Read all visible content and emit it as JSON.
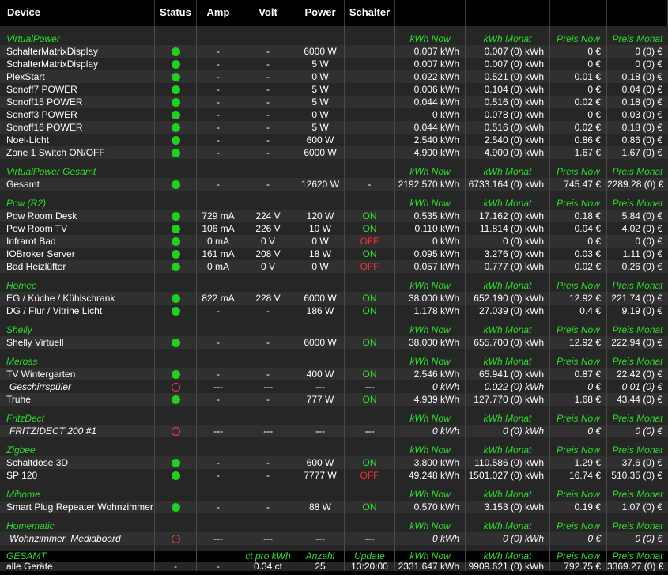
{
  "columns": [
    "Device",
    "Status",
    "Amp",
    "Volt",
    "Power",
    "Schalter",
    "",
    "",
    "",
    ""
  ],
  "section_cols": [
    "kWh Now",
    "kWh Monat",
    "Preis Now",
    "Preis Monat"
  ],
  "sections": [
    {
      "name": "VirtualPower",
      "rows": [
        {
          "device": "SchalterMatrixDisplay",
          "status": "on",
          "amp": "-",
          "volt": "-",
          "power": "6000 W",
          "switch": "",
          "kwh_now": "0.007 kWh",
          "kwh_month": "0.007 (0) kWh",
          "price_now": "0 €",
          "price_month": "0 (0) €"
        },
        {
          "device": "SchalterMatrixDisplay",
          "status": "on",
          "amp": "-",
          "volt": "-",
          "power": "5 W",
          "switch": "",
          "kwh_now": "0.007 kWh",
          "kwh_month": "0.007 (0) kWh",
          "price_now": "0 €",
          "price_month": "0 (0) €"
        },
        {
          "device": "PlexStart",
          "status": "on",
          "amp": "-",
          "volt": "-",
          "power": "0 W",
          "switch": "",
          "kwh_now": "0.022 kWh",
          "kwh_month": "0.521 (0) kWh",
          "price_now": "0.01 €",
          "price_month": "0.18 (0) €"
        },
        {
          "device": "Sonoff7 POWER",
          "status": "on",
          "amp": "-",
          "volt": "-",
          "power": "5 W",
          "switch": "",
          "kwh_now": "0.006 kWh",
          "kwh_month": "0.104 (0) kWh",
          "price_now": "0 €",
          "price_month": "0.04 (0) €"
        },
        {
          "device": "Sonoff15 POWER",
          "status": "on",
          "amp": "-",
          "volt": "-",
          "power": "5 W",
          "switch": "",
          "kwh_now": "0.044 kWh",
          "kwh_month": "0.516 (0) kWh",
          "price_now": "0.02 €",
          "price_month": "0.18 (0) €"
        },
        {
          "device": "Sonoff3 POWER",
          "status": "on",
          "amp": "-",
          "volt": "-",
          "power": "0 W",
          "switch": "",
          "kwh_now": "0 kWh",
          "kwh_month": "0.078 (0) kWh",
          "price_now": "0 €",
          "price_month": "0.03 (0) €"
        },
        {
          "device": "Sonoff16 POWER",
          "status": "on",
          "amp": "-",
          "volt": "-",
          "power": "5 W",
          "switch": "",
          "kwh_now": "0.044 kWh",
          "kwh_month": "0.516 (0) kWh",
          "price_now": "0.02 €",
          "price_month": "0.18 (0) €"
        },
        {
          "device": "Noel-Licht",
          "status": "on",
          "amp": "-",
          "volt": "-",
          "power": "600 W",
          "switch": "",
          "kwh_now": "2.540 kWh",
          "kwh_month": "2.540 (0) kWh",
          "price_now": "0.86 €",
          "price_month": "0.86 (0) €"
        },
        {
          "device": "Zone 1 Switch ON/OFF",
          "status": "on",
          "amp": "-",
          "volt": "-",
          "power": "6000 W",
          "switch": "",
          "kwh_now": "4.900 kWh",
          "kwh_month": "4.900 (0) kWh",
          "price_now": "1.67 €",
          "price_month": "1.67 (0) €"
        }
      ]
    },
    {
      "name": "VirtualPower Gesamt",
      "rows": [
        {
          "device": "Gesamt",
          "status": "on",
          "amp": "-",
          "volt": "-",
          "power": "12620 W",
          "switch": "-",
          "kwh_now": "2192.570 kWh",
          "kwh_month": "6733.164 (0) kWh",
          "price_now": "745.47 €",
          "price_month": "2289.28 (0) €"
        }
      ]
    },
    {
      "name": "Pow (R2)",
      "rows": [
        {
          "device": "Pow Room Desk",
          "status": "on",
          "amp": "729 mA",
          "volt": "224 V",
          "power": "120 W",
          "switch": "ON",
          "kwh_now": "0.535 kWh",
          "kwh_month": "17.162 (0) kWh",
          "price_now": "0.18 €",
          "price_month": "5.84 (0) €"
        },
        {
          "device": "Pow Room TV",
          "status": "on",
          "amp": "106 mA",
          "volt": "226 V",
          "power": "10 W",
          "switch": "ON",
          "kwh_now": "0.110 kWh",
          "kwh_month": "11.814 (0) kWh",
          "price_now": "0.04 €",
          "price_month": "4.02 (0) €"
        },
        {
          "device": "Infrarot Bad",
          "status": "on",
          "amp": "0 mA",
          "volt": "0 V",
          "power": "0 W",
          "switch": "OFF",
          "kwh_now": "0 kWh",
          "kwh_month": "0 (0) kWh",
          "price_now": "0 €",
          "price_month": "0 (0) €"
        },
        {
          "device": "IOBroker Server",
          "status": "on",
          "amp": "161 mA",
          "volt": "208 V",
          "power": "18 W",
          "switch": "ON",
          "kwh_now": "0.095 kWh",
          "kwh_month": "3.276 (0) kWh",
          "price_now": "0.03 €",
          "price_month": "1.11 (0) €"
        },
        {
          "device": "Bad Heizlüfter",
          "status": "on",
          "amp": "0 mA",
          "volt": "0 V",
          "power": "0 W",
          "switch": "OFF",
          "kwh_now": "0.057 kWh",
          "kwh_month": "0.777 (0) kWh",
          "price_now": "0.02 €",
          "price_month": "0.26 (0) €"
        }
      ]
    },
    {
      "name": "Homee",
      "rows": [
        {
          "device": "EG / Küche / Kühlschrank",
          "status": "on",
          "amp": "822 mA",
          "volt": "228 V",
          "power": "6000 W",
          "switch": "ON",
          "kwh_now": "38.000 kWh",
          "kwh_month": "652.190 (0) kWh",
          "price_now": "12.92 €",
          "price_month": "221.74 (0) €"
        },
        {
          "device": "DG / Flur / Vitrine Licht",
          "status": "on",
          "amp": "-",
          "volt": "-",
          "power": "186 W",
          "switch": "ON",
          "kwh_now": "1.178 kWh",
          "kwh_month": "27.039 (0) kWh",
          "price_now": "0.4 €",
          "price_month": "9.19 (0) €"
        }
      ]
    },
    {
      "name": "Shelly",
      "rows": [
        {
          "device": "Shelly Virtuell",
          "status": "on",
          "amp": "-",
          "volt": "-",
          "power": "6000 W",
          "switch": "ON",
          "kwh_now": "38.000 kWh",
          "kwh_month": "655.700 (0) kWh",
          "price_now": "12.92 €",
          "price_month": "222.94 (0) €"
        }
      ]
    },
    {
      "name": "Meross",
      "rows": [
        {
          "device": "TV Wintergarten",
          "status": "on",
          "amp": "-",
          "volt": "-",
          "power": "400 W",
          "switch": "ON",
          "kwh_now": "2.546 kWh",
          "kwh_month": "65.941 (0) kWh",
          "price_now": "0.87 €",
          "price_month": "22.42 (0) €"
        },
        {
          "device": "Geschirrspüler",
          "status": "offline",
          "amp": "---",
          "volt": "---",
          "power": "---",
          "switch": "---",
          "kwh_now": "0 kWh",
          "kwh_month": "0.022 (0) kWh",
          "price_now": "0 €",
          "price_month": "0.01 (0) €"
        },
        {
          "device": "Truhe",
          "status": "on",
          "amp": "-",
          "volt": "-",
          "power": "777 W",
          "switch": "ON",
          "kwh_now": "4.939 kWh",
          "kwh_month": "127.770 (0) kWh",
          "price_now": "1.68 €",
          "price_month": "43.44 (0) €"
        }
      ]
    },
    {
      "name": "FritzDect",
      "rows": [
        {
          "device": "FRITZ!DECT 200 #1",
          "status": "offline",
          "amp": "---",
          "volt": "---",
          "power": "---",
          "switch": "---",
          "kwh_now": "0 kWh",
          "kwh_month": "0 (0) kWh",
          "price_now": "0 €",
          "price_month": "0 (0) €"
        }
      ]
    },
    {
      "name": "Zigbee",
      "rows": [
        {
          "device": "Schaltdose 3D",
          "status": "on",
          "amp": "-",
          "volt": "-",
          "power": "600 W",
          "switch": "ON",
          "kwh_now": "3.800 kWh",
          "kwh_month": "110.586 (0) kWh",
          "price_now": "1.29 €",
          "price_month": "37.6 (0) €"
        },
        {
          "device": "SP 120",
          "status": "on",
          "amp": "-",
          "volt": "-",
          "power": "7777 W",
          "switch": "OFF",
          "kwh_now": "49.248 kWh",
          "kwh_month": "1501.027 (0) kWh",
          "price_now": "16.74 €",
          "price_month": "510.35 (0) €"
        }
      ]
    },
    {
      "name": "Mihome",
      "rows": [
        {
          "device": "Smart Plug Repeater Wohnzimmer",
          "status": "on",
          "amp": "-",
          "volt": "-",
          "power": "88 W",
          "switch": "ON",
          "kwh_now": "0.570 kWh",
          "kwh_month": "3.153 (0) kWh",
          "price_now": "0.19 €",
          "price_month": "1.07 (0) €"
        }
      ]
    },
    {
      "name": "Homematic",
      "rows": [
        {
          "device": "Wohnzimmer_Mediaboard",
          "status": "offline",
          "amp": "---",
          "volt": "---",
          "power": "---",
          "switch": "---",
          "kwh_now": "0 kWh",
          "kwh_month": "0 (0) kWh",
          "price_now": "0 €",
          "price_month": "0 (0) €"
        }
      ]
    }
  ],
  "total": {
    "label": "GESAMT",
    "ct_label": "ct pro kWh",
    "count_label": "Anzahl",
    "update_label": "Update",
    "device": "alle Geräte",
    "status": "-",
    "amp": "-",
    "ct": "0.34 ct",
    "count": "25",
    "update": "13:20:00",
    "kwh_now": "2331.647 kWh",
    "kwh_month": "9909.621 (0) kWh",
    "price_now": "792.75 €",
    "price_month": "3369.27 (0) €"
  },
  "colors": {
    "accent_green": "#28e028",
    "on_green": "#2ee02e",
    "off_red": "#ff2b2b",
    "dot_green": "#1fd11f"
  }
}
